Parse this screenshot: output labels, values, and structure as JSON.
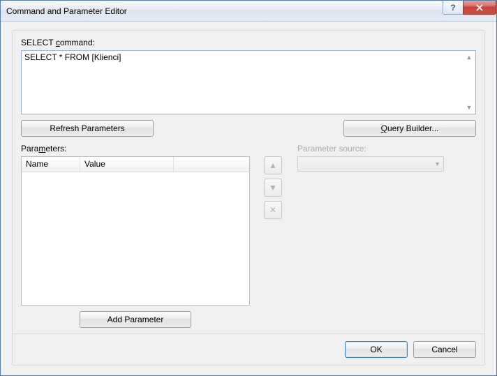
{
  "window": {
    "title": "Command and Parameter Editor"
  },
  "labels": {
    "select_command_pre": "SELECT ",
    "select_command_mn": "c",
    "select_command_post": "ommand:",
    "parameters_pre": "Para",
    "parameters_mn": "m",
    "parameters_post": "eters:",
    "parameter_source": "Parameter source:"
  },
  "sql": {
    "text": "SELECT * FROM [Klienci]"
  },
  "buttons": {
    "refresh": "Refresh Parameters",
    "query_builder_pre": "",
    "query_builder_mn": "Q",
    "query_builder_post": "uery Builder...",
    "add_parameter": "Add Parameter",
    "ok": "OK",
    "cancel": "Cancel"
  },
  "grid": {
    "col_name": "Name",
    "col_value": "Value"
  },
  "icons": {
    "help": "?",
    "up": "▲",
    "down": "▼",
    "x": "✕",
    "combo_arrow": "▼",
    "scroll_up": "▲",
    "scroll_down": "▼"
  }
}
